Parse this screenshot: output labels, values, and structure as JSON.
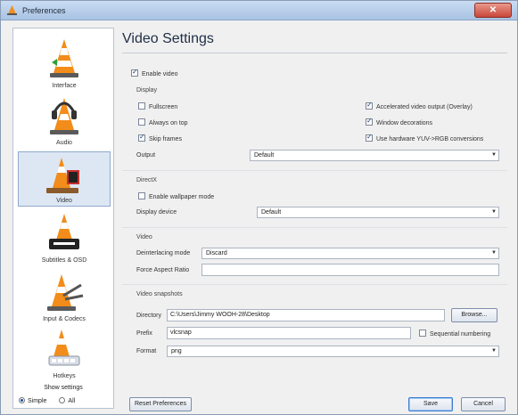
{
  "window": {
    "title": "Preferences",
    "close_icon": "close-icon"
  },
  "sidebar": {
    "items": [
      {
        "label": "Interface",
        "icon": "cone-icon"
      },
      {
        "label": "Audio",
        "icon": "headphones-cone-icon"
      },
      {
        "label": "Video",
        "icon": "film-cone-icon",
        "selected": true
      },
      {
        "label": "Subtitles & OSD",
        "icon": "subtitle-cone-icon"
      },
      {
        "label": "Input & Codecs",
        "icon": "codec-cone-icon"
      },
      {
        "label": "Hotkeys",
        "icon": "hotkey-cone-icon"
      }
    ],
    "show_settings": "Show settings",
    "mode_simple": "Simple",
    "mode_all": "All"
  },
  "page": {
    "title": "Video Settings"
  },
  "video": {
    "enable_video": "Enable video",
    "display_heading": "Display",
    "fullscreen": "Fullscreen",
    "always_on_top": "Always on top",
    "skip_frames": "Skip frames",
    "accelerated": "Accelerated video output (Overlay)",
    "window_decorations": "Window decorations",
    "hardware_yuv": "Use hardware YUV->RGB conversions",
    "output_label": "Output",
    "output_value": "Default"
  },
  "directx": {
    "heading": "DirectX",
    "wallpaper": "Enable wallpaper mode",
    "device_label": "Display device",
    "device_value": "Default"
  },
  "video2": {
    "heading": "Video",
    "deinterlace_label": "Deinterlacing mode",
    "deinterlace_value": "Discard",
    "aspect_label": "Force Aspect Ratio",
    "aspect_value": ""
  },
  "snapshots": {
    "heading": "Video snapshots",
    "directory_label": "Directory",
    "directory_value": "C:\\Users\\Jimmy WOOH-28\\Desktop",
    "browse": "Browse...",
    "prefix_label": "Prefix",
    "prefix_value": "vlcsnap",
    "sequential": "Sequential numbering",
    "format_label": "Format",
    "format_value": "png"
  },
  "footer": {
    "reset": "Reset Preferences",
    "save": "Save",
    "cancel": "Cancel"
  },
  "colors": {
    "accent": "#1f2d46",
    "selected_bg": "#dde7f4",
    "cone_orange": "#f28c1a"
  }
}
